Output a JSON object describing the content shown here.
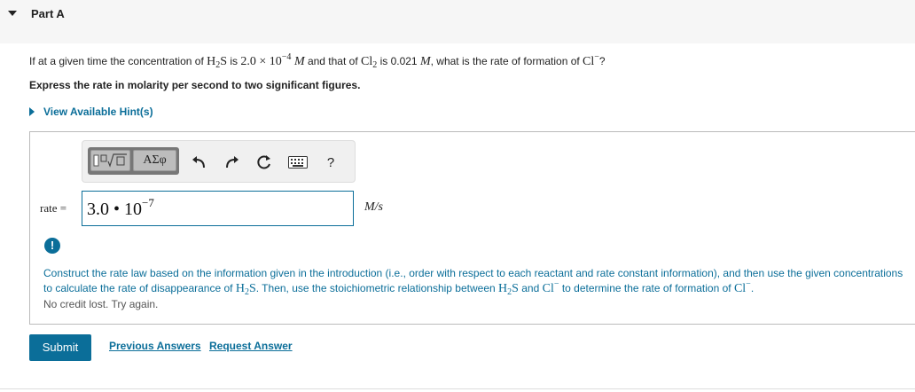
{
  "part": {
    "title": "Part A"
  },
  "question": {
    "t1": "If at a given time the concentration of ",
    "h2s_h": "H",
    "h2s_2": "2",
    "h2s_s": "S",
    "t2": " is ",
    "conc1": "2.0 × 10",
    "conc1_exp": "−4",
    "unit_m": "M",
    "t3": " and that of ",
    "cl2_cl": "Cl",
    "cl2_2": "2",
    "t4": " is ",
    "conc2": "0.021",
    "t5": ", what is the rate of formation of ",
    "cl_minus": "Cl",
    "minus": "−",
    "t6": "?"
  },
  "instruction": "Express the rate in molarity per second to two significant figures.",
  "hint": {
    "label": "View Available Hint(s)"
  },
  "toolbar": {
    "greek_label": "ΑΣφ",
    "help_label": "?"
  },
  "answer": {
    "label": "rate =",
    "mantissa": "3.0",
    "bullet": "•",
    "base": "10",
    "exponent": "−7",
    "unit": "M/s"
  },
  "feedback": {
    "icon": "!",
    "f1": "Construct the rate law based on the information given in the introduction (i.e., order with respect to each reactant and rate constant information), and then use the given concentrations to calculate the rate of disappearance of ",
    "f2": ". Then, use the stoichiometric relationship between ",
    "f3": " and ",
    "f4": " to determine the rate of formation of ",
    "f5": ".",
    "no_credit": "No credit lost. Try again."
  },
  "actions": {
    "submit": "Submit",
    "previous": "Previous Answers",
    "request": "Request Answer"
  },
  "colors": {
    "accent": "#0b6e99",
    "header_bg": "#f6f6f6"
  }
}
